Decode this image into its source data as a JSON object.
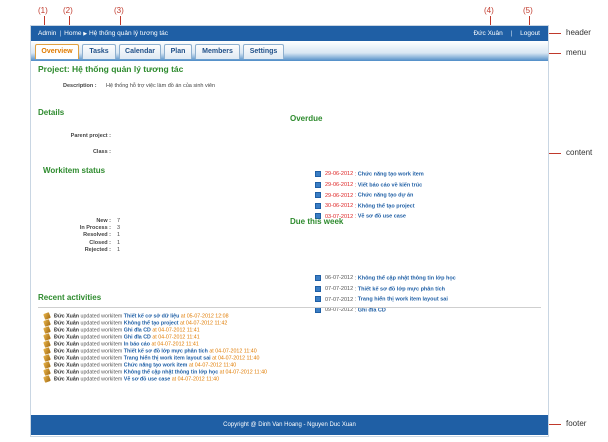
{
  "callouts": [
    "(1)",
    "(2)",
    "(3)",
    "(4)",
    "(5)"
  ],
  "side_labels": {
    "header": "header",
    "menu": "menu",
    "content": "content",
    "footer": "footer"
  },
  "header": {
    "user": "Admin",
    "home": "Home",
    "arrow": "▶",
    "breadcrumb_current": "Hệ thống quản lý tương tác",
    "account_name": "Đức Xuân",
    "logout": "Logout"
  },
  "menu": {
    "tabs": [
      {
        "label": "Overview",
        "active": true
      },
      {
        "label": "Tasks"
      },
      {
        "label": "Calendar"
      },
      {
        "label": "Plan"
      },
      {
        "label": "Members"
      },
      {
        "label": "Settings"
      }
    ]
  },
  "project": {
    "title": "Project: Hệ thống quản lý tương tác",
    "description_label": "Description :",
    "description": "Hệ thống hỗ trợ việc làm đồ án của sinh viên"
  },
  "details": {
    "title": "Details",
    "parent_label": "Parent project :",
    "parent_value": "",
    "class_label": "Class :",
    "class_value": ""
  },
  "workitem_status": {
    "title": "Workitem status",
    "rows": [
      {
        "label": "New :",
        "value": "7"
      },
      {
        "label": "In Process :",
        "value": "3"
      },
      {
        "label": "Resolved :",
        "value": "1"
      },
      {
        "label": "Closed :",
        "value": "1"
      },
      {
        "label": "Rejected :",
        "value": "1"
      }
    ]
  },
  "overdue": {
    "title": "Overdue",
    "items": [
      {
        "date": "29-06-2012",
        "sep": " : ",
        "title": "Chức năng tạo work item"
      },
      {
        "date": "29-06-2012",
        "sep": " : ",
        "title": "Viết báo cáo về kiến trúc"
      },
      {
        "date": "29-06-2012",
        "sep": " : ",
        "title": "Chức năng tạo dự án"
      },
      {
        "date": "30-06-2012",
        "sep": " : ",
        "title": "Không thể tạo project"
      },
      {
        "date": "03-07-2012",
        "sep": " : ",
        "title": "Vẽ sơ đồ use case"
      }
    ]
  },
  "due_this_week": {
    "title": "Due this week",
    "items": [
      {
        "date": "06-07-2012",
        "sep": " : ",
        "title": "Không thể cập nhật thông tin lớp học"
      },
      {
        "date": "07-07-2012",
        "sep": " : ",
        "title": "Thiết kế sơ đồ lớp mực phân tích"
      },
      {
        "date": "07-07-2012",
        "sep": " : ",
        "title": "Trang hiển thị work item layout sai"
      },
      {
        "date": "09-07-2012",
        "sep": " : ",
        "title": "Ghi đĩa CD"
      }
    ]
  },
  "recent_activities": {
    "title": "Recent activities",
    "items": [
      {
        "user": "Đức Xuân",
        "verb": " updated workitem ",
        "title": "Thiết kế cơ sở dữ liệu",
        "ts": " at 05-07-2012 12:08"
      },
      {
        "user": "Đức Xuân",
        "verb": " updated workitem ",
        "title": "Không thể tạo project",
        "ts": " at 04-07-2012 11:42"
      },
      {
        "user": "Đức Xuân",
        "verb": " updated workitem ",
        "title": "Ghi đĩa CD",
        "ts": " at 04-07-2012 11:41"
      },
      {
        "user": "Đức Xuân",
        "verb": " updated workitem ",
        "title": "Ghi đĩa CD",
        "ts": " at 04-07-2012 11:41"
      },
      {
        "user": "Đức Xuân",
        "verb": " updated workitem ",
        "title": "In báo cáo",
        "ts": " at 04-07-2012 11:41"
      },
      {
        "user": "Đức Xuân",
        "verb": " updated workitem ",
        "title": "Thiết kế sơ đồ lớp mực phân tích",
        "ts": " at 04-07-2012 11:40"
      },
      {
        "user": "Đức Xuân",
        "verb": " updated workitem ",
        "title": "Trang hiển thị work item layout sai",
        "ts": " at 04-07-2012 11:40"
      },
      {
        "user": "Đức Xuân",
        "verb": " updated workitem ",
        "title": "Chức năng tạo work item",
        "ts": " at 04-07-2012 11:40"
      },
      {
        "user": "Đức Xuân",
        "verb": " updated workitem ",
        "title": "Không thể cập nhật thông tin lớp học",
        "ts": " at 04-07-2012 11:40"
      },
      {
        "user": "Đức Xuân",
        "verb": " updated workitem ",
        "title": "Vẽ sơ đồ use case",
        "ts": " at 04-07-2012 11:40"
      }
    ]
  },
  "footer": {
    "copyright": "Copyright @ Dinh Van Hoang - Nguyen Duc Xuan"
  },
  "colors": {
    "brand": "#1f5fa5",
    "section_green": "#2e8b2e",
    "overdue_red": "#dd2222",
    "timestamp_orange": "#e07b00",
    "callout_red": "#c0392b"
  }
}
